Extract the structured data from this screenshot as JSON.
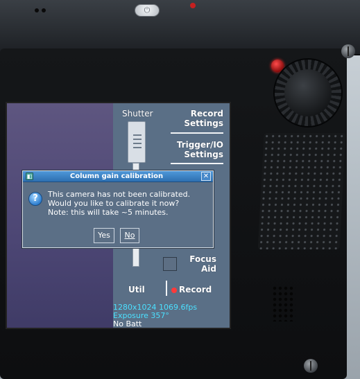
{
  "screen": {
    "shutter_label": "Shutter",
    "record_settings_label": "Record Settings",
    "trigger_io_label": "Trigger/IO Settings",
    "focus_aid_label": "Focus Aid",
    "util_label": "Util",
    "record_label": "Record",
    "status": {
      "resolution_fps": "1280x1024 1069.6fps",
      "exposure": "Exposure 357°",
      "battery": "No Batt"
    }
  },
  "dialog": {
    "title": "Column gain calibration",
    "message_lines": [
      "This camera has not been calibrated.",
      "Would you like to calibrate it now?",
      "Note: this will take ~5 minutes."
    ],
    "yes_label": "Yes",
    "no_label": "No",
    "close_glyph": "✕"
  },
  "icons": {
    "power": "power-icon",
    "question": "question-icon",
    "app": "app-icon",
    "close": "close-icon"
  },
  "colors": {
    "panel": "#5a6f86",
    "title_bar": "#2d6fb0",
    "status_cyan": "#4be0ff",
    "record_dot": "#ff3a3a",
    "live_view": "#4c4674"
  }
}
